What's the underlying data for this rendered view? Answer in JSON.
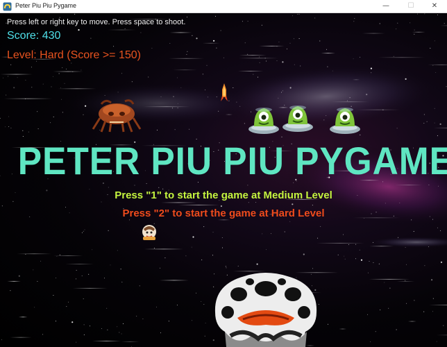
{
  "window": {
    "title": "Peter Piu Piu Pygame",
    "minimize_glyph": "—",
    "maximize_glyph": "☐",
    "close_glyph": "✕"
  },
  "hud": {
    "instructions": "Press left or right key to move. Press space to shoot.",
    "score": "Score: 430",
    "level": "Level: Hard (Score >= 150)"
  },
  "title_screen": {
    "title": "PETER PIU PIU PYGAME",
    "option_medium": "Press \"1\" to start the game at Medium Level",
    "option_hard": "Press \"2\" to start the game at Hard Level"
  },
  "icons": {
    "app": "pygame-snake-icon",
    "bullet": "rocket-bullet-icon",
    "crab_enemy": "crab-monster-icon",
    "alien": "green-alien-ufo-icon",
    "player": "player-sprite-icon",
    "boss": "spotted-boss-monster-icon"
  },
  "colors": {
    "score": "#4fe0e9",
    "level": "#e8531f",
    "title": "#5fe6c2",
    "medium": "#c5f53f",
    "hard": "#ee4b1c"
  }
}
